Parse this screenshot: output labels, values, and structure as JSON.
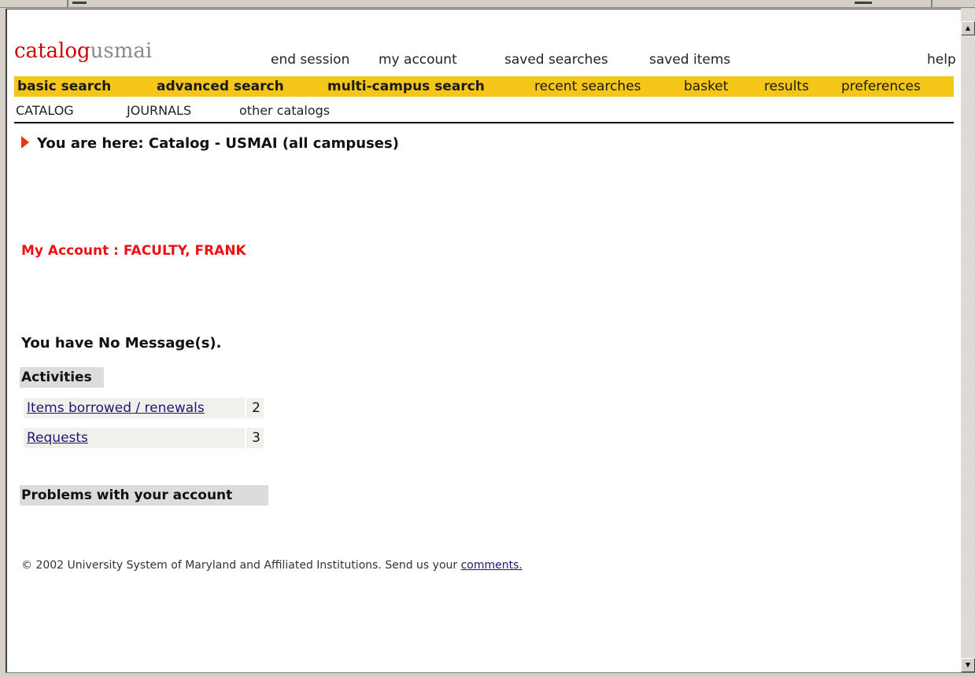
{
  "header": {
    "logo_primary": "catalog",
    "logo_secondary": "usmai",
    "top_links": [
      "end session",
      "my account",
      "saved searches",
      "saved items",
      "help"
    ]
  },
  "nav": {
    "primary": [
      {
        "label": "basic search",
        "bold": true
      },
      {
        "label": "advanced search",
        "bold": true
      },
      {
        "label": "multi-campus search",
        "bold": true
      },
      {
        "label": "recent searches",
        "bold": false
      },
      {
        "label": "basket",
        "bold": false
      },
      {
        "label": "results",
        "bold": false
      },
      {
        "label": "preferences",
        "bold": false
      }
    ],
    "secondary": [
      "CATALOG",
      "JOURNALS",
      "other catalogs"
    ]
  },
  "breadcrumb": "You are here: Catalog - USMAI (all campuses)",
  "account_title": "My Account : FACULTY, FRANK",
  "messages_text": "You have No Message(s).",
  "activities": {
    "heading": "Activities",
    "rows": [
      {
        "label": "Items borrowed / renewals",
        "count": "2"
      },
      {
        "label": "Requests",
        "count": "3"
      }
    ]
  },
  "problems_heading": "Problems with your account",
  "footer": {
    "text": "© 2002 University System of Maryland and Affiliated Institutions. Send us your",
    "link": "comments."
  },
  "colors": {
    "brand_red": "#cc0000",
    "nav_yellow": "#f5c518",
    "account_red": "#ee1111",
    "arrow_orange": "#e63a00"
  },
  "icons": {
    "breadcrumb_arrow": "triangle-right-icon",
    "scroll_up": "scroll-up-arrow-icon",
    "scroll_down": "scroll-down-arrow-icon"
  }
}
